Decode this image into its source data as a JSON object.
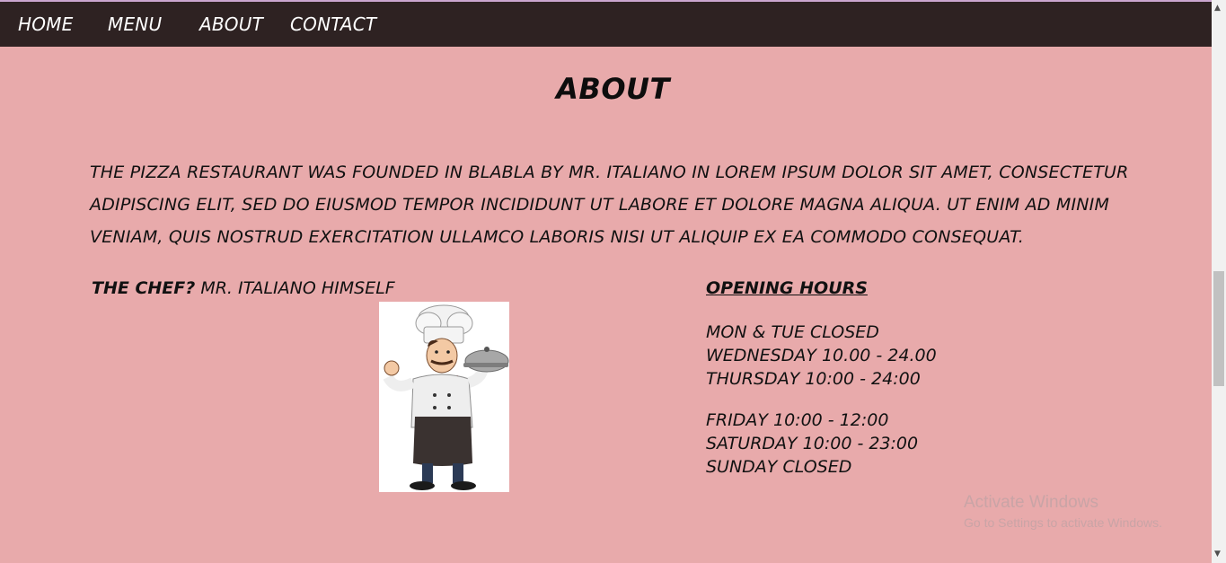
{
  "nav": {
    "home": "HOME",
    "menu": "MENU",
    "about": "ABOUT",
    "contact": "CONTACT"
  },
  "page": {
    "title": "ABOUT",
    "intro": "THE PIZZA RESTAURANT WAS FOUNDED IN BLABLA BY MR. ITALIANO IN LOREM IPSUM DOLOR SIT AMET, CONSECTETUR ADIPISCING ELIT, SED DO EIUSMOD TEMPOR INCIDIDUNT UT LABORE ET DOLORE MAGNA ALIQUA. UT ENIM AD MINIM VENIAM, QUIS NOSTRUD EXERCITATION ULLAMCO LABORIS NISI UT ALIQUIP EX EA COMMODO CONSEQUAT."
  },
  "chef": {
    "label": "THE CHEF?",
    "name": "MR. ITALIANO HIMSELF"
  },
  "hours": {
    "title": "OPENING HOURS",
    "group1": [
      "MON & TUE CLOSED",
      "WEDNESDAY 10.00 - 24.00",
      "THURSDAY 10:00 - 24:00"
    ],
    "group2": [
      "FRIDAY 10:00 - 12:00",
      "SATURDAY 10:00 - 23:00",
      "SUNDAY CLOSED"
    ]
  },
  "watermark": {
    "line1": "Activate Windows",
    "line2": "Go to Settings to activate Windows."
  },
  "colors": {
    "background": "#e8aaab",
    "navbar": "#2e2222",
    "text": "#111111"
  }
}
